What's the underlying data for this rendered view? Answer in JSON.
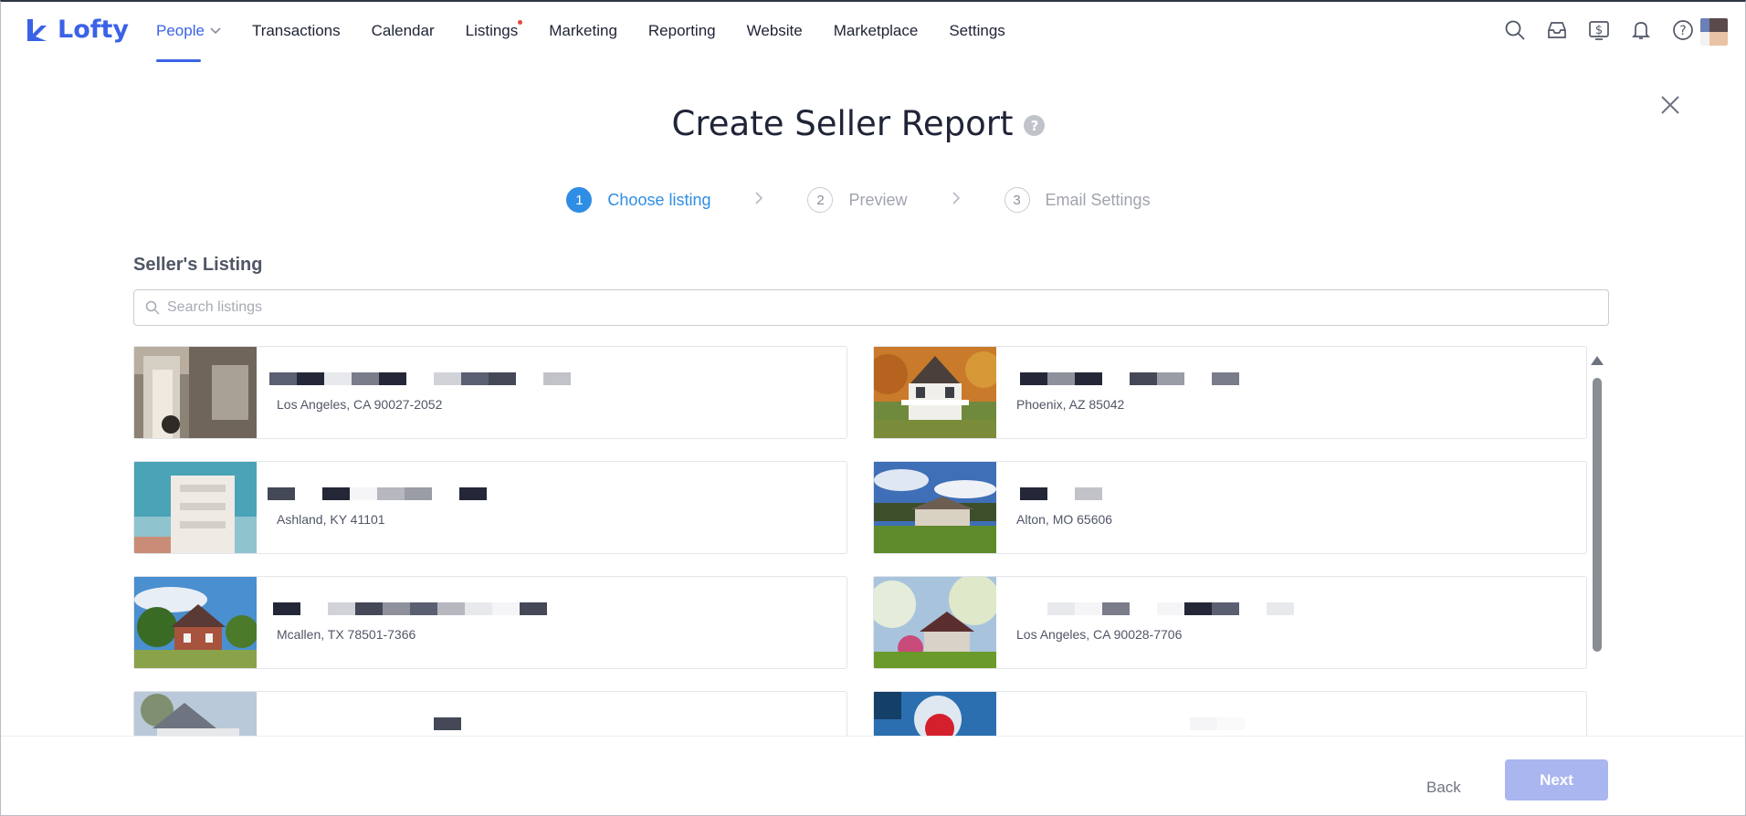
{
  "brand": {
    "name": "Lofty",
    "color": "#3b62e6"
  },
  "nav": {
    "items": [
      {
        "label": "People",
        "active": true,
        "has_dropdown": true
      },
      {
        "label": "Transactions"
      },
      {
        "label": "Calendar"
      },
      {
        "label": "Listings",
        "has_dot": true
      },
      {
        "label": "Marketing"
      },
      {
        "label": "Reporting"
      },
      {
        "label": "Website"
      },
      {
        "label": "Marketplace"
      },
      {
        "label": "Settings"
      }
    ],
    "icons": [
      "search-icon",
      "inbox-icon",
      "dollar-icon",
      "bell-icon",
      "help-icon"
    ]
  },
  "modal": {
    "title": "Create Seller Report",
    "help_badge": "?",
    "steps": [
      {
        "num": "1",
        "label": "Choose listing",
        "active": true
      },
      {
        "num": "2",
        "label": "Preview"
      },
      {
        "num": "3",
        "label": "Email Settings"
      }
    ],
    "section_label": "Seller's Listing",
    "search": {
      "placeholder": "Search listings",
      "value": ""
    },
    "listings": [
      {
        "address": "Los Angeles, CA 90027-2052",
        "image": "porch-columns"
      },
      {
        "address": "Phoenix, AZ 85042",
        "image": "white-house-autumn"
      },
      {
        "address": "Ashland, KY 41101",
        "image": "white-building"
      },
      {
        "address": "Alton, MO 65606",
        "image": "ranch-house"
      },
      {
        "address": "Mcallen, TX 78501-7366",
        "image": "brick-house"
      },
      {
        "address": "Los Angeles, CA 90028-7706",
        "image": "cottage-garden"
      },
      {
        "address": "",
        "image": "gray-house"
      },
      {
        "address": "",
        "image": "red-object"
      }
    ],
    "footer": {
      "back_label": "Back",
      "next_label": "Next"
    }
  }
}
